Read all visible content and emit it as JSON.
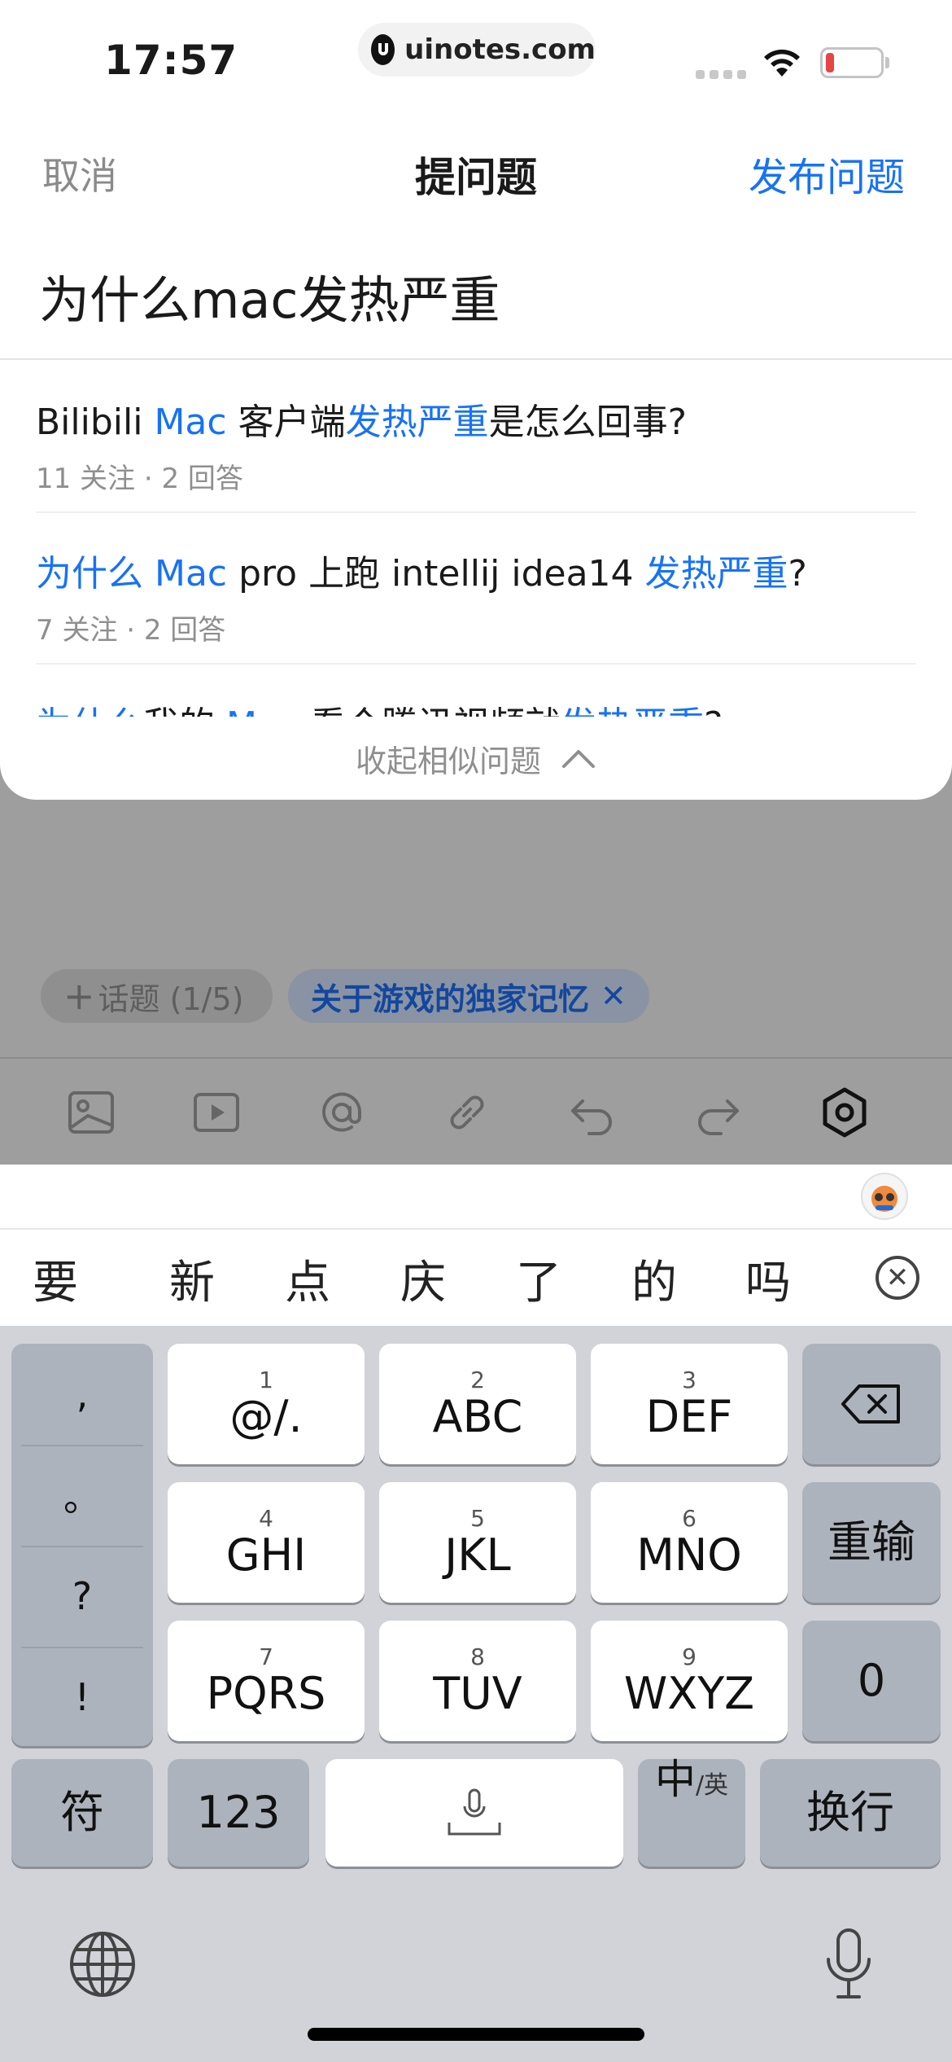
{
  "status": {
    "time": "17:57",
    "url": "uinotes.com"
  },
  "nav": {
    "cancel": "取消",
    "title": "提问题",
    "publish": "发布问题"
  },
  "question": {
    "text": "为什么mac发热严重"
  },
  "similar": {
    "items": [
      {
        "parts": [
          {
            "t": "Bilibili ",
            "h": false
          },
          {
            "t": "Mac",
            "h": true
          },
          {
            "t": " 客户端",
            "h": false
          },
          {
            "t": "发热严重",
            "h": true
          },
          {
            "t": "是怎么回事?",
            "h": false
          }
        ],
        "meta": "11 关注 · 2 回答"
      },
      {
        "parts": [
          {
            "t": "为什么",
            "h": true
          },
          {
            "t": " ",
            "h": false
          },
          {
            "t": "Mac",
            "h": true
          },
          {
            "t": " pro 上跑 intellij idea14 ",
            "h": false
          },
          {
            "t": "发热严重",
            "h": true
          },
          {
            "t": "?",
            "h": false
          }
        ],
        "meta": "7 关注 · 2 回答"
      },
      {
        "parts": [
          {
            "t": "为什么",
            "h": true
          },
          {
            "t": "我的 ",
            "h": false
          },
          {
            "t": "Mac",
            "h": true
          },
          {
            "t": " 看个腾讯视频就",
            "h": false
          },
          {
            "t": "发热严重",
            "h": true
          },
          {
            "t": "?",
            "h": false
          }
        ],
        "meta": ""
      }
    ],
    "collapse_label": "收起相似问题"
  },
  "tags": {
    "add_label": "话题 (1/5)",
    "add_plus": "+",
    "topic_label": "关于游戏的独家记忆",
    "topic_remove": "✕"
  },
  "toolbar": {
    "icons": [
      "image-icon",
      "video-icon",
      "mention-icon",
      "link-icon",
      "undo-icon",
      "redo-icon",
      "settings-icon"
    ]
  },
  "candidates": {
    "words": [
      "要",
      "新",
      "点",
      "庆",
      "了",
      "的",
      "吗"
    ]
  },
  "keyboard": {
    "punct": [
      ",",
      "。",
      "?",
      "!"
    ],
    "row1": [
      {
        "num": "1",
        "lbl": "@/."
      },
      {
        "num": "2",
        "lbl": "ABC"
      },
      {
        "num": "3",
        "lbl": "DEF"
      }
    ],
    "row2": [
      {
        "num": "4",
        "lbl": "GHI"
      },
      {
        "num": "5",
        "lbl": "JKL"
      },
      {
        "num": "6",
        "lbl": "MNO"
      }
    ],
    "row3": [
      {
        "num": "7",
        "lbl": "PQRS"
      },
      {
        "num": "8",
        "lbl": "TUV"
      },
      {
        "num": "9",
        "lbl": "WXYZ"
      }
    ],
    "reset": "重输",
    "zero": "0",
    "symbol": "符",
    "numbers": "123",
    "lang_main": "中",
    "lang_sub": "/英",
    "enter": "换行"
  },
  "colors": {
    "accent": "#1772f6",
    "dim": "#9e9e9e",
    "keyboard_bg": "#d1d3d9"
  }
}
